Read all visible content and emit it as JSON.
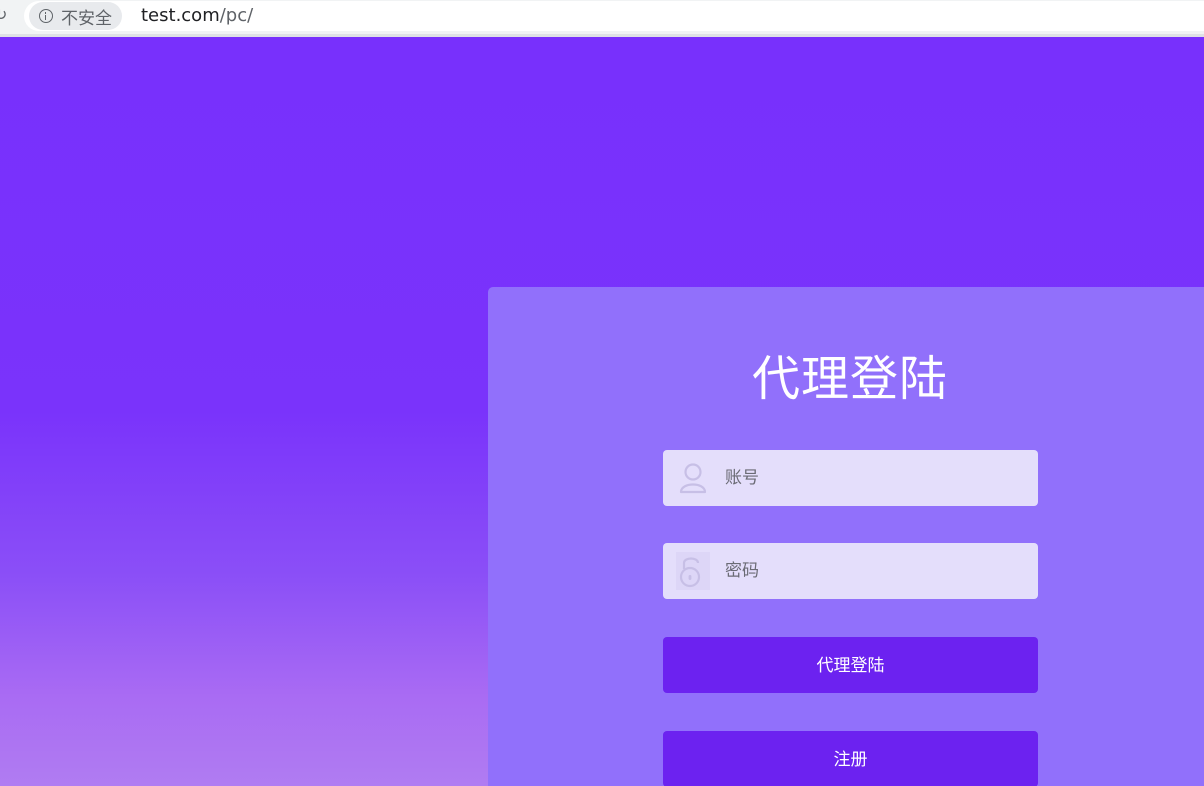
{
  "browser": {
    "security_label": "不安全",
    "url_host": "test.com",
    "url_path": "/pc/"
  },
  "login": {
    "title": "代理登陆",
    "account_placeholder": "账号",
    "password_placeholder": "密码",
    "login_button": "代理登陆",
    "register_button": "注册"
  },
  "colors": {
    "background": "#7830fc",
    "card": "#9170fb",
    "button": "#6c22f0",
    "input": "#e4defb"
  }
}
